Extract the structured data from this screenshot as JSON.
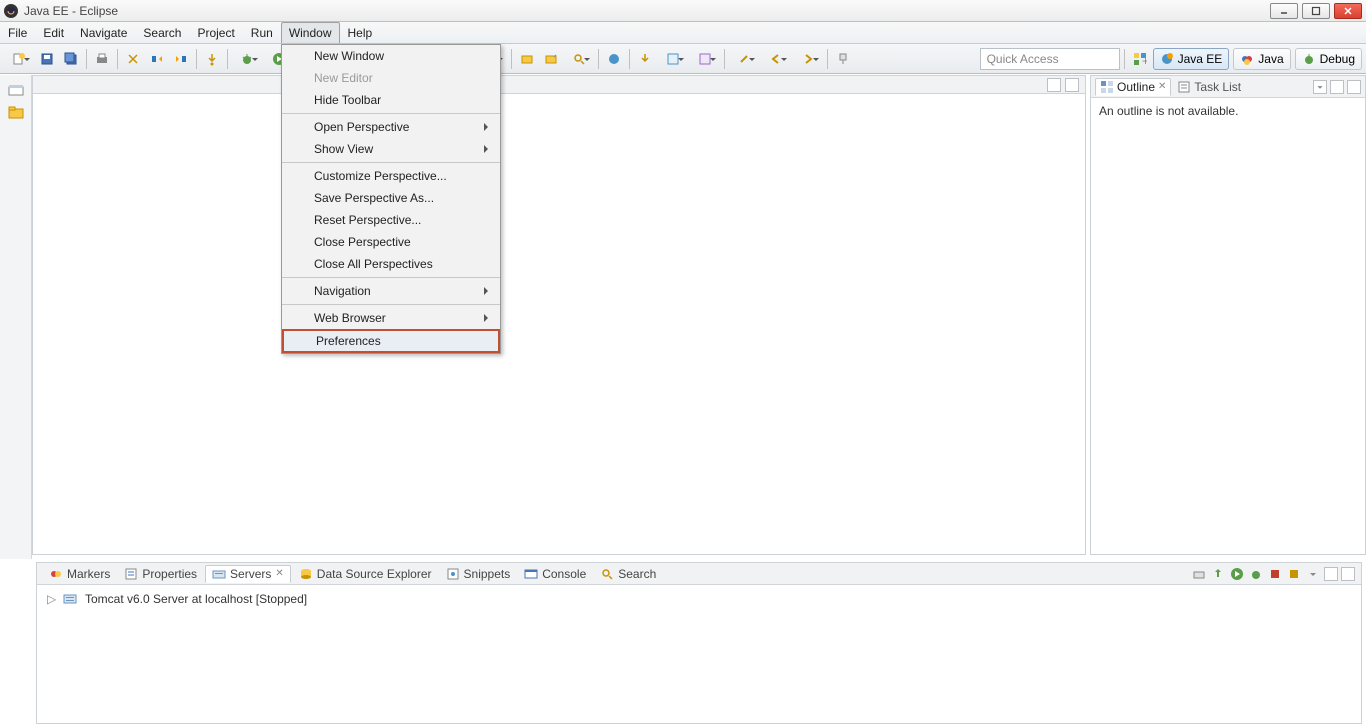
{
  "title": "Java EE - Eclipse",
  "menubar": [
    "File",
    "Edit",
    "Navigate",
    "Search",
    "Project",
    "Run",
    "Window",
    "Help"
  ],
  "active_menu_index": 6,
  "dropdown": {
    "groups": [
      [
        {
          "label": "New Window",
          "sub": false,
          "disabled": false
        },
        {
          "label": "New Editor",
          "sub": false,
          "disabled": true
        },
        {
          "label": "Hide Toolbar",
          "sub": false,
          "disabled": false
        }
      ],
      [
        {
          "label": "Open Perspective",
          "sub": true,
          "disabled": false
        },
        {
          "label": "Show View",
          "sub": true,
          "disabled": false
        }
      ],
      [
        {
          "label": "Customize Perspective...",
          "sub": false,
          "disabled": false
        },
        {
          "label": "Save Perspective As...",
          "sub": false,
          "disabled": false
        },
        {
          "label": "Reset Perspective...",
          "sub": false,
          "disabled": false
        },
        {
          "label": "Close Perspective",
          "sub": false,
          "disabled": false
        },
        {
          "label": "Close All Perspectives",
          "sub": false,
          "disabled": false
        }
      ],
      [
        {
          "label": "Navigation",
          "sub": true,
          "disabled": false
        }
      ],
      [
        {
          "label": "Web Browser",
          "sub": true,
          "disabled": false
        },
        {
          "label": "Preferences",
          "sub": false,
          "disabled": false,
          "highlight": true
        }
      ]
    ]
  },
  "quick_access_placeholder": "Quick Access",
  "perspectives": [
    {
      "label": "Java EE",
      "active": true,
      "icon": "javaee"
    },
    {
      "label": "Java",
      "active": false,
      "icon": "java"
    },
    {
      "label": "Debug",
      "active": false,
      "icon": "debug"
    }
  ],
  "right_panel": {
    "tabs": [
      {
        "label": "Outline",
        "active": true
      },
      {
        "label": "Task List",
        "active": false
      }
    ],
    "body_text": "An outline is not available."
  },
  "bottom_panel": {
    "tabs": [
      {
        "label": "Markers",
        "active": false
      },
      {
        "label": "Properties",
        "active": false
      },
      {
        "label": "Servers",
        "active": true
      },
      {
        "label": "Data Source Explorer",
        "active": false
      },
      {
        "label": "Snippets",
        "active": false
      },
      {
        "label": "Console",
        "active": false
      },
      {
        "label": "Search",
        "active": false
      }
    ],
    "server_row": "Tomcat v6.0 Server at localhost  [Stopped]"
  }
}
